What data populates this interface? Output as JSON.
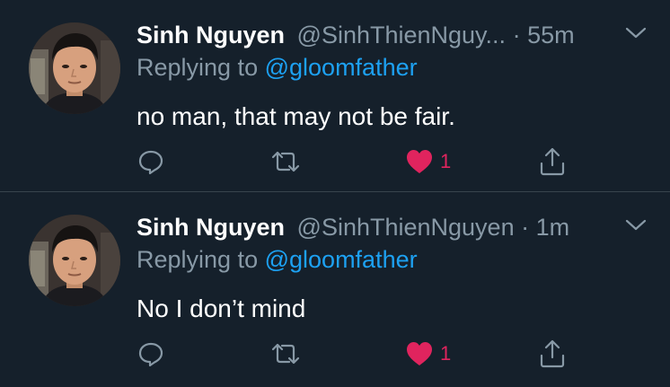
{
  "tweets": [
    {
      "name": "Sinh Nguyen",
      "handle": "@SinhThienNguy...",
      "separator": "·",
      "time": "55m",
      "replying_label": "Replying to",
      "replying_to": "@gloomfather",
      "text": "no man, that may not be fair.",
      "like_count": "1"
    },
    {
      "name": "Sinh Nguyen",
      "handle": "@SinhThienNguyen",
      "separator": "·",
      "time": "1m",
      "replying_label": "Replying to",
      "replying_to": "@gloomfather",
      "text": "No I don’t mind",
      "like_count": "1"
    }
  ],
  "colors": {
    "background": "#15202b",
    "secondary_text": "#8899a6",
    "mention": "#1da1f2",
    "like": "#e0245e",
    "divider": "#38444d"
  },
  "icons": [
    "reply-icon",
    "retweet-icon",
    "heart-icon",
    "share-icon",
    "chevron-down-icon"
  ]
}
